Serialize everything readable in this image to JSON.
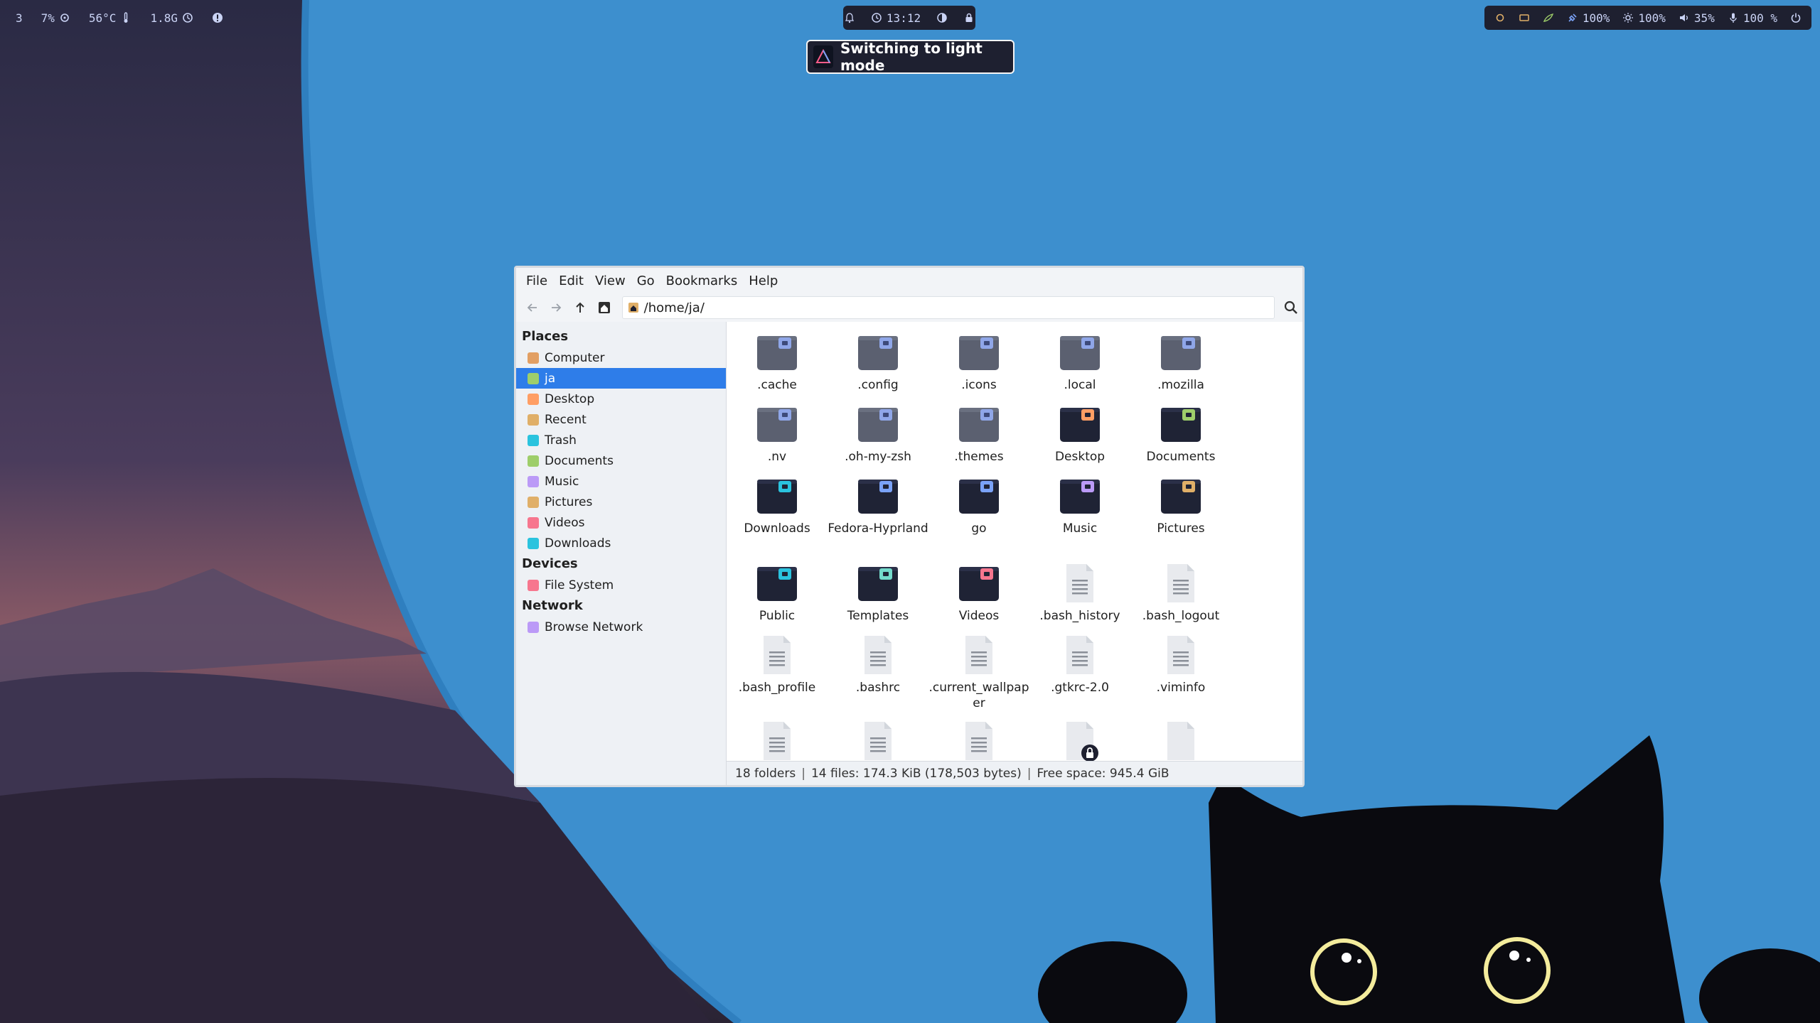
{
  "topbar": {
    "left": {
      "workspace": "3",
      "cpu": "7%",
      "temp": "56°C",
      "memory": "1.8G"
    },
    "center": {
      "clock": "13:12"
    },
    "right": {
      "battery": "100%",
      "brightness": "100%",
      "volume": "35%",
      "mic": "100 %"
    }
  },
  "notification": {
    "text": "Switching to light mode"
  },
  "window": {
    "menu": [
      "File",
      "Edit",
      "View",
      "Go",
      "Bookmarks",
      "Help"
    ],
    "location": "/home/ja/",
    "sidebar": {
      "places_heading": "Places",
      "places": [
        {
          "label": "Computer",
          "color": "#e29f63"
        },
        {
          "label": "ja",
          "color": "#9ece6a",
          "active": true
        },
        {
          "label": "Desktop",
          "color": "#ff9e64"
        },
        {
          "label": "Recent",
          "color": "#e0af68"
        },
        {
          "label": "Trash",
          "color": "#2ac3de"
        },
        {
          "label": "Documents",
          "color": "#9ece6a"
        },
        {
          "label": "Music",
          "color": "#bb9af7"
        },
        {
          "label": "Pictures",
          "color": "#e0af68"
        },
        {
          "label": "Videos",
          "color": "#f7768e"
        },
        {
          "label": "Downloads",
          "color": "#2ac3de"
        }
      ],
      "devices_heading": "Devices",
      "devices": [
        {
          "label": "File System",
          "color": "#f7768e"
        }
      ],
      "network_heading": "Network",
      "network": [
        {
          "label": "Browse Network",
          "color": "#bb9af7"
        }
      ]
    },
    "files": [
      {
        "name": ".cache",
        "type": "hidden-folder"
      },
      {
        "name": ".config",
        "type": "hidden-folder"
      },
      {
        "name": ".icons",
        "type": "hidden-folder"
      },
      {
        "name": ".local",
        "type": "hidden-folder"
      },
      {
        "name": ".mozilla",
        "type": "hidden-folder"
      },
      {
        "name": ".nv",
        "type": "hidden-folder"
      },
      {
        "name": ".oh-my-zsh",
        "type": "hidden-folder"
      },
      {
        "name": ".themes",
        "type": "hidden-folder"
      },
      {
        "name": "Desktop",
        "type": "folder",
        "accent": "#ff9e64"
      },
      {
        "name": "Documents",
        "type": "folder",
        "accent": "#9ece6a"
      },
      {
        "name": "Downloads",
        "type": "folder",
        "accent": "#2ac3de"
      },
      {
        "name": "Fedora-Hyprland",
        "type": "folder",
        "accent": "#7aa2f7"
      },
      {
        "name": "go",
        "type": "folder",
        "accent": "#7aa2f7"
      },
      {
        "name": "Music",
        "type": "folder",
        "accent": "#bb9af7"
      },
      {
        "name": "Pictures",
        "type": "folder",
        "accent": "#e0af68"
      },
      {
        "name": "Public",
        "type": "folder",
        "accent": "#2ac3de"
      },
      {
        "name": "Templates",
        "type": "folder",
        "accent": "#73daca"
      },
      {
        "name": "Videos",
        "type": "folder",
        "accent": "#f7768e"
      },
      {
        "name": ".bash_history",
        "type": "text"
      },
      {
        "name": ".bash_logout",
        "type": "text"
      },
      {
        "name": ".bash_profile",
        "type": "text"
      },
      {
        "name": ".bashrc",
        "type": "text"
      },
      {
        "name": ".current_wallpaper",
        "type": "text"
      },
      {
        "name": ".gtkrc-2.0",
        "type": "text"
      },
      {
        "name": ".viminfo",
        "type": "text"
      },
      {
        "name": "",
        "type": "text"
      },
      {
        "name": "",
        "type": "text"
      },
      {
        "name": "",
        "type": "text"
      },
      {
        "name": "",
        "type": "locked"
      },
      {
        "name": "",
        "type": "blank"
      }
    ],
    "status": {
      "folders": "18 folders",
      "files": "14 files: 174.3 KiB (178,503 bytes)",
      "free": "Free space: 945.4 GiB",
      "separator": "|"
    }
  }
}
